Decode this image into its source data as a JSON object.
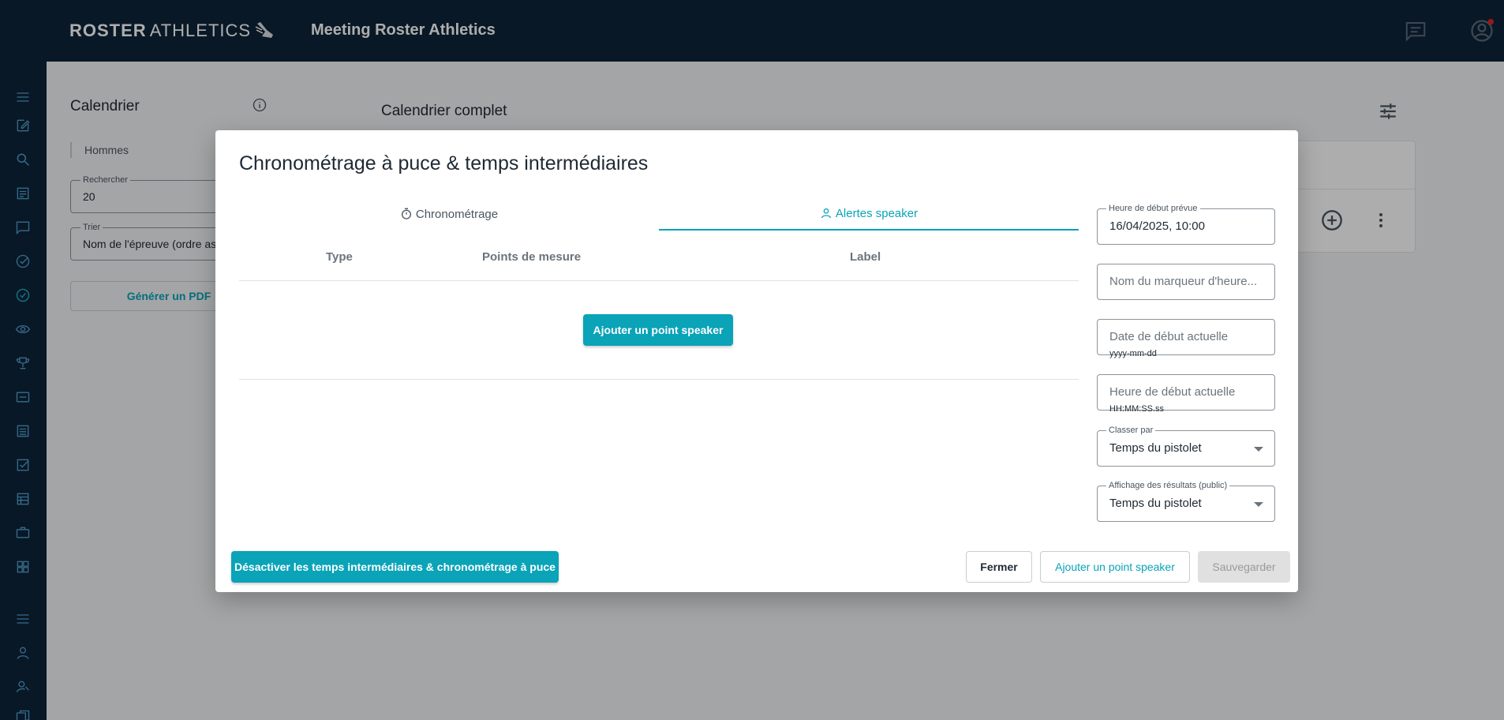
{
  "app": {
    "brand_bold": "ROSTER",
    "brand_light": "ATHLETICS",
    "title": "Meeting Roster Athletics"
  },
  "background": {
    "calendar_title": "Calendrier",
    "filter_chip": "Hommes",
    "search": {
      "label": "Rechercher",
      "value": "20"
    },
    "sort": {
      "label": "Trier",
      "value": "Nom de l'épreuve (ordre ascendant)"
    },
    "pdf_button": "Générer un PDF",
    "full_calendar_title": "Calendrier complet"
  },
  "modal": {
    "title": "Chronométrage à puce & temps intermédiaires",
    "tabs": [
      {
        "label": "Chronométrage",
        "icon": "stopwatch-icon",
        "active": false
      },
      {
        "label": "Alertes speaker",
        "icon": "person-icon",
        "active": true
      }
    ],
    "table": {
      "headers": [
        "Type",
        "Points de mesure",
        "Label"
      ]
    },
    "add_point_button": "Ajouter un point speaker",
    "fields": {
      "planned_start": {
        "label": "Heure de début prévue",
        "value": "16/04/2025, 10:00"
      },
      "marker_name": {
        "placeholder": "Nom du marqueur d'heure..."
      },
      "actual_start_date": {
        "placeholder": "Date de début actuelle",
        "helper": "yyyy-mm-dd"
      },
      "actual_start_time": {
        "placeholder": "Heure de début actuelle",
        "helper": "HH:MM:SS.ss"
      },
      "rank_by": {
        "label": "Classer par",
        "value": "Temps du pistolet"
      },
      "results_display": {
        "label": "Affichage des résultats (public)",
        "value": "Temps du pistolet"
      }
    },
    "footer": {
      "disable_button": "Désactiver les temps intermédiaires & chronométrage à puce",
      "close_button": "Fermer",
      "add_button": "Ajouter un point speaker",
      "save_button": "Sauvegarder"
    }
  },
  "colors": {
    "topbar": "#0e2438",
    "accent": "#0aa3b8",
    "notification_dot": "#e02424"
  },
  "sidebar_icons": [
    "menu-icon",
    "edit-icon",
    "search-icon",
    "list-icon",
    "chat-icon",
    "check-circle-icon",
    "check-circle-active-icon",
    "eye-icon",
    "trophy-icon",
    "ticket-icon",
    "document-icon",
    "checkbox-icon",
    "table-icon",
    "briefcase-icon",
    "grid-icon",
    "menu-icon",
    "person-icon",
    "person-key-icon",
    "cards-icon"
  ]
}
